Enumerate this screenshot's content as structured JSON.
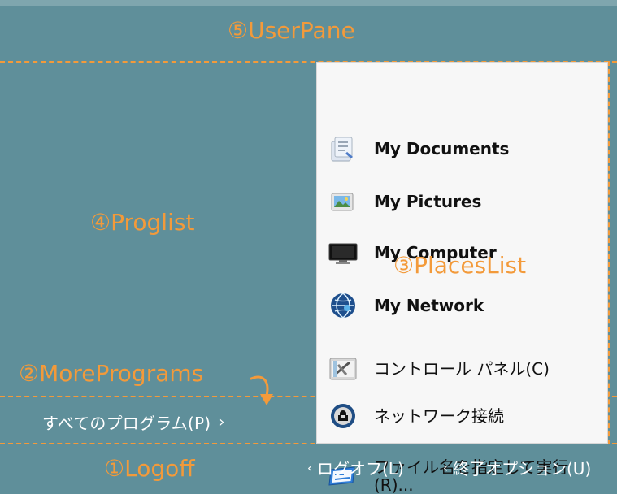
{
  "callouts": {
    "user_pane": "⑤UserPane",
    "proglist": "④Proglist",
    "places_list": "③PlacesList",
    "more_programs": "②MorePrograms",
    "logoff": "①Logoff"
  },
  "places": [
    {
      "label": "My Documents",
      "icon": "documents-icon"
    },
    {
      "label": "My Pictures",
      "icon": "pictures-icon"
    },
    {
      "label": "My Computer",
      "icon": "computer-icon"
    },
    {
      "label": "My Network",
      "icon": "network-icon"
    },
    {
      "label": "コントロール パネル(C)",
      "icon": "control-panel-icon"
    },
    {
      "label": "ネットワーク接続",
      "icon": "network-connections-icon"
    },
    {
      "label": "ファイル名を指定して実行 (R)...",
      "icon": "run-icon"
    }
  ],
  "all_programs": {
    "label": "すべてのプログラム(P)",
    "chevron": "›"
  },
  "footer": {
    "logoff": "ログオフ(L)",
    "shutdown": "終了オプション(U)",
    "chevron": "‹"
  },
  "colors": {
    "background": "#5f8f9a",
    "panel": "#f7f7f7",
    "accent": "#f39a3a",
    "text_light": "#ffffff",
    "text_dark": "#111111"
  }
}
